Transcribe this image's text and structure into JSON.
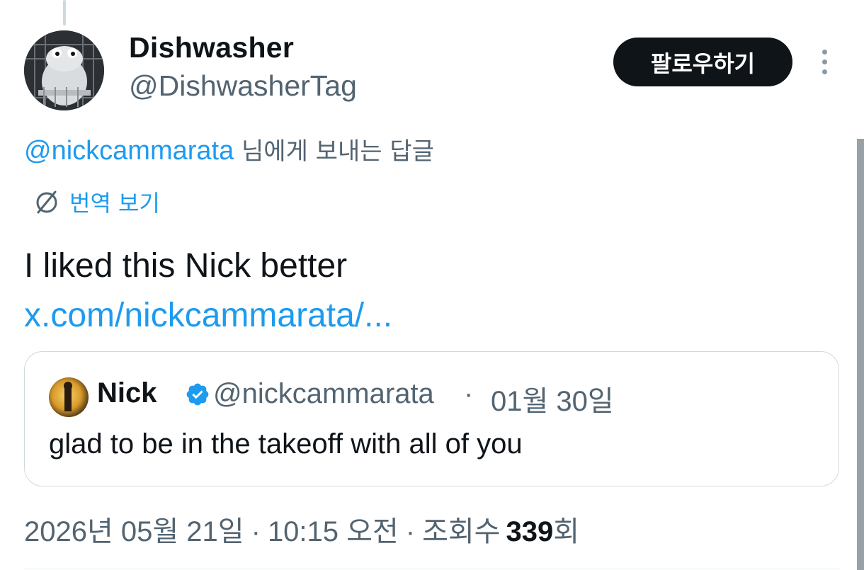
{
  "author": {
    "name": "Dishwasher",
    "handle": "@DishwasherTag",
    "avatar_icon": "dishwasher-character-avatar"
  },
  "follow_label": "팔로우하기",
  "more_icon": "vertical-ellipsis-icon",
  "reply_context": {
    "mention": "@nickcammarata",
    "suffix": " 님에게 보내는 답글"
  },
  "translate_label": "번역 보기",
  "translate_icon": "globe-translate-icon",
  "tweet": {
    "text": "I liked this Nick better",
    "link": "x.com/nickcammarata/..."
  },
  "quote": {
    "name": "Nick",
    "verified": true,
    "handle": "@nickcammarata",
    "separator": "·",
    "date": "01월 30일",
    "text": "glad to be in the takeoff with all of you"
  },
  "meta": {
    "date": "2026년 05월 21일",
    "time": "10:15 오전",
    "views_label": "조회수",
    "views_count": "339",
    "views_suffix": "회",
    "separator": "·"
  },
  "colors": {
    "accent": "#1d9bf0",
    "text_primary": "#0f1419",
    "text_secondary": "#536471",
    "button_bg": "#0f1419",
    "border": "#cfd9de"
  }
}
